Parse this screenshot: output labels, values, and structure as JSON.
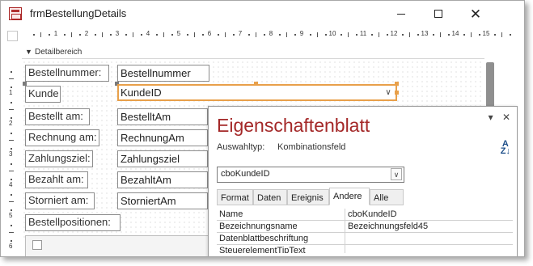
{
  "window": {
    "title": "frmBestellungDetails",
    "minimize_glyph": "minimize",
    "maximize_glyph": "maximize",
    "close_glyph": "✕"
  },
  "ruler": {
    "numbers": [
      "1",
      "2",
      "3",
      "4",
      "5",
      "6",
      "7",
      "8",
      "9",
      "10",
      "11",
      "12",
      "13",
      "14",
      "15"
    ],
    "vertical_numbers": [
      "1",
      "2",
      "3",
      "4",
      "5",
      "6"
    ]
  },
  "section": {
    "label": "Detailbereich",
    "arrow": "▼"
  },
  "form": {
    "labels": [
      "Bestellnummer:",
      "Kunde",
      "Bestellt am:",
      "Rechnung am:",
      "Zahlungsziel:",
      "Bezahlt am:",
      "Storniert am:",
      "Bestellpositionen:"
    ],
    "fields": [
      "Bestellnummer",
      "KundeID",
      "BestelltAm",
      "RechnungAm",
      "Zahlungsziel",
      "BezahltAm",
      "StorniertAm"
    ],
    "dropdown_glyph": "∨"
  },
  "property_sheet": {
    "title": "Eigenschaftenblatt",
    "pin_glyph": "▾",
    "close_glyph": "✕",
    "selection_type_label": "Auswahltyp:",
    "selection_type_value": "Kombinationsfeld",
    "sort_glyph_top": "A",
    "sort_glyph_bottom": "Z↓",
    "object": "cboKundeID",
    "tabs": [
      "Format",
      "Daten",
      "Ereignis",
      "Andere",
      "Alle"
    ],
    "active_tab": "Andere",
    "rows": [
      {
        "name": "Name",
        "value": "cboKundeID"
      },
      {
        "name": "Bezeichnungsname",
        "value": "Bezeichnungsfeld45"
      },
      {
        "name": "Datenblattbeschriftung",
        "value": ""
      },
      {
        "name": "SteuerelementTipText",
        "value": ""
      }
    ]
  },
  "colors": {
    "accent_title": "#a42828",
    "selection": "#e8a04a"
  }
}
